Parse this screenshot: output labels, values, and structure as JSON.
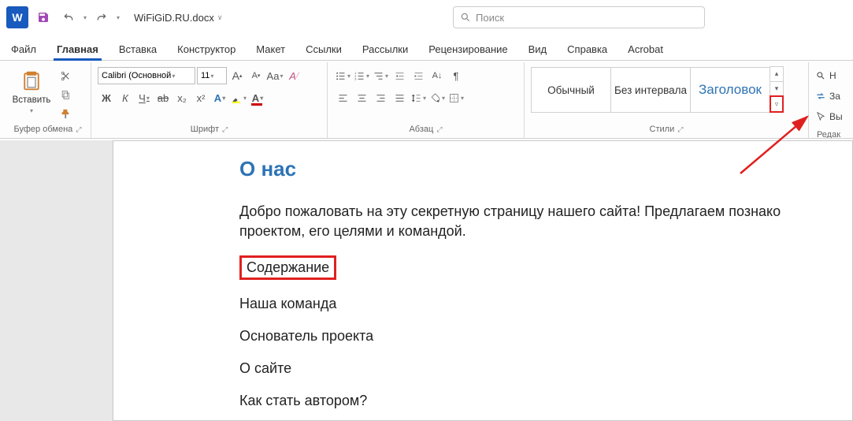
{
  "titlebar": {
    "filename": "WiFiGiD.RU.docx",
    "search_placeholder": "Поиск"
  },
  "tabs": [
    "Файл",
    "Главная",
    "Вставка",
    "Конструктор",
    "Макет",
    "Ссылки",
    "Рассылки",
    "Рецензирование",
    "Вид",
    "Справка",
    "Acrobat"
  ],
  "active_tab": "Главная",
  "ribbon": {
    "clipboard": {
      "paste": "Вставить",
      "group_label": "Буфер обмена"
    },
    "font": {
      "name": "Calibri (Основной",
      "size": "11",
      "group_label": "Шрифт",
      "bold": "Ж",
      "italic": "К",
      "underline": "Ч",
      "strike": "ab",
      "sub": "x₂",
      "sup": "x²",
      "aa": "Aa",
      "clear": "A"
    },
    "paragraph": {
      "group_label": "Абзац"
    },
    "styles": {
      "items": [
        "Обычный",
        "Без интервала",
        "Заголовок"
      ],
      "group_label": "Стили"
    },
    "editing": {
      "find": "Н",
      "replace": "За",
      "select": "Вы",
      "group_label": "Редак"
    }
  },
  "document": {
    "heading": "О нас",
    "para1": "Добро пожаловать на эту секретную страницу нашего сайта! Предлагаем познако",
    "para2": "проектом, его целями и командой.",
    "toc": [
      "Содержание",
      "Наша команда",
      "Основатель проекта",
      "О сайте",
      "Как стать автором?"
    ],
    "highlighted_toc": "Содержание"
  }
}
